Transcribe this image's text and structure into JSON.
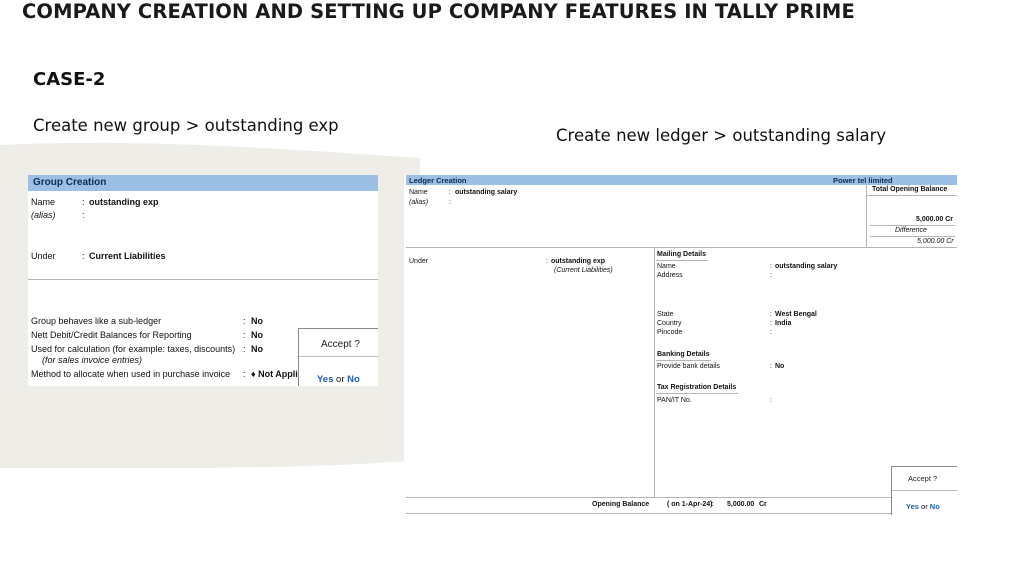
{
  "slide": {
    "title": "COMPANY CREATION AND SETTING UP COMPANY FEATURES IN TALLY PRIME",
    "case": "CASE-2",
    "caption_left": "Create new group > outstanding exp",
    "caption_right": "Create new ledger > outstanding salary"
  },
  "group_creation": {
    "header": "Group Creation",
    "name_label": "Name",
    "name_value": "outstanding exp",
    "alias_label": "(alias)",
    "under_label": "Under",
    "under_value": "Current Liabilities",
    "questions": [
      {
        "label": "Group behaves like a sub-ledger",
        "value": "No"
      },
      {
        "label": "Nett Debit/Credit Balances for Reporting",
        "value": "No"
      },
      {
        "label": "Used for calculation (for example: taxes, discounts)",
        "value": "No"
      },
      {
        "label": "Method to allocate when used in purchase invoice",
        "value": "♦ Not Appli"
      }
    ],
    "sub_note": "(for sales invoice entries)",
    "accept": {
      "title": "Accept ?",
      "yes": "Yes",
      "or": "or",
      "no": "No"
    }
  },
  "ledger_creation": {
    "header": "Ledger Creation",
    "company": "Power tel limited",
    "name_label": "Name",
    "name_value": "outstanding salary",
    "alias_label": "(alias)",
    "total_opening_label": "Total Opening Balance",
    "total_opening_value": "5,000.00 Cr",
    "difference_label": "Difference",
    "difference_value": "5,000.00 Cr",
    "under_label": "Under",
    "under_value": "outstanding exp",
    "under_parent": "(Current Liabilities)",
    "mailing": {
      "heading": "Mailing Details",
      "name_label": "Name",
      "name_value": "outstanding salary",
      "address_label": "Address",
      "state_label": "State",
      "state_value": "West Bengal",
      "country_label": "Country",
      "country_value": "India",
      "pincode_label": "Pincode"
    },
    "banking": {
      "heading": "Banking Details",
      "label": "Provide bank details",
      "value": "No"
    },
    "tax": {
      "heading": "Tax Registration Details",
      "pan_label": "PAN/IT No."
    },
    "opening": {
      "label": "Opening Balance",
      "date": "( on 1-Apr-24)",
      "value": "5,000.00",
      "type": "Cr"
    },
    "accept": {
      "title": "Accept ?",
      "yes": "Yes",
      "or": "or",
      "no": "No"
    }
  },
  "colors": {
    "header_bar": "#9cc0e3",
    "accept_blue": "#1f5fb2",
    "swoosh": "#eeede8"
  }
}
